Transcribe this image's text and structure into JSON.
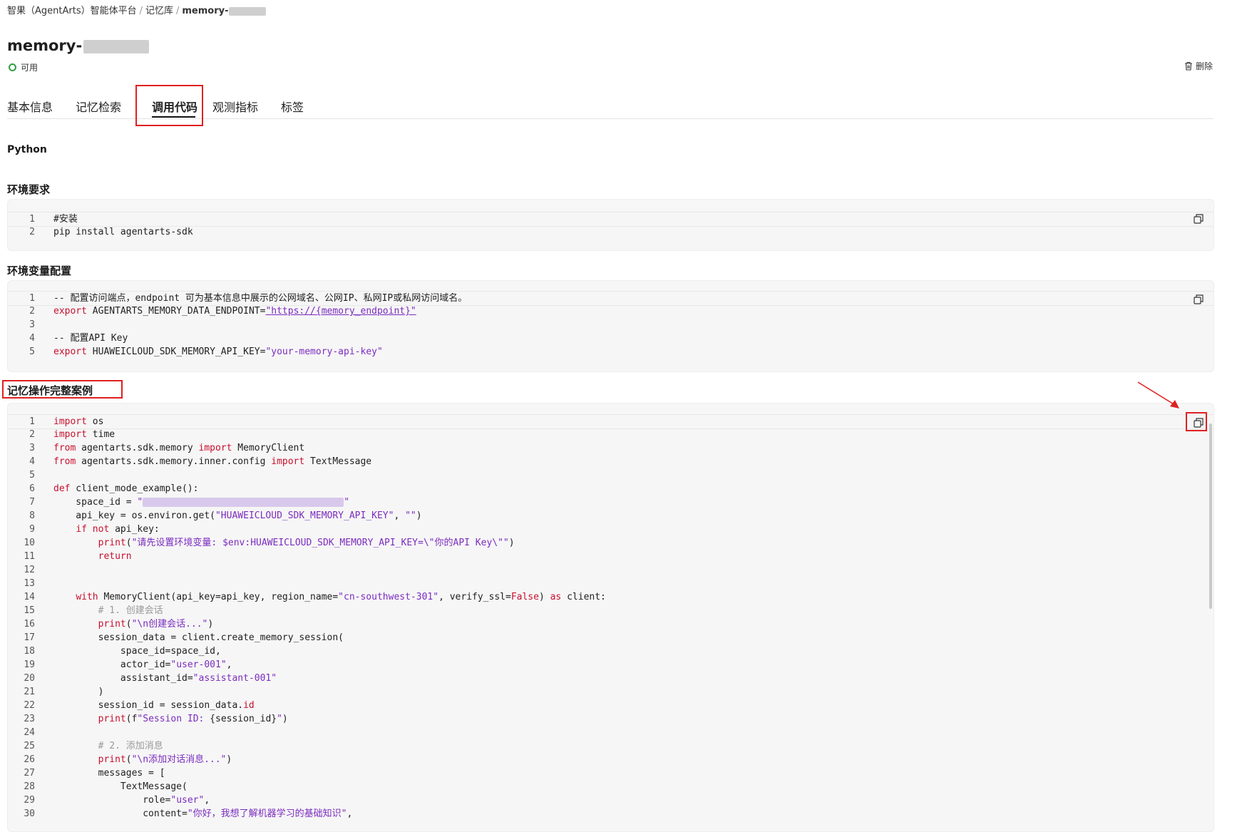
{
  "breadcrumb": {
    "items": [
      "智果（AgentArts）智能体平台",
      "记忆库"
    ],
    "separator": "/",
    "current": "memory-"
  },
  "header": {
    "title": "memory-",
    "status": "可用",
    "delete_label": "删除"
  },
  "tabs": [
    {
      "label": "基本信息"
    },
    {
      "label": "记忆检索"
    },
    {
      "label": "调用代码",
      "active": true
    },
    {
      "label": "观测指标"
    },
    {
      "label": "标签"
    }
  ],
  "language": "Python",
  "sections": {
    "env_requirements": {
      "title": "环境要求",
      "lines": [
        "#安装",
        "pip install agentarts-sdk"
      ]
    },
    "env_config": {
      "title": "环境变量配置",
      "line1": "-- 配置访问端点，endpoint 可为基本信息中展示的公网域名、公网IP、私网IP或私网访问域名。",
      "line2_prefix": "AGENTARTS_MEMORY_DATA_ENDPOINT=",
      "line2_value": "\"https://{memory_endpoint}\"",
      "line4": "-- 配置API Key",
      "line5_prefix": "HUAWEICLOUD_SDK_MEMORY_API_KEY=",
      "line5_value": "\"your-memory-api-key\""
    },
    "example": {
      "title": "记忆操作完整案例"
    }
  },
  "colors": {
    "keyword": "#c8102e",
    "string": "#7b2cbf",
    "comment": "#9a9a9a",
    "highlight_box": "#e02020",
    "status_ok": "#2f9e44"
  },
  "icons": [
    "copy-icon",
    "trash-icon",
    "arrow-annotation"
  ]
}
